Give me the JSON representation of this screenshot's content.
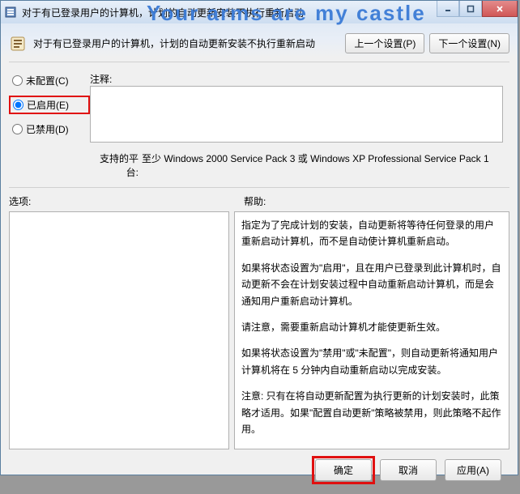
{
  "window": {
    "title": "对于有已登录用户的计算机，计划的自动更新安装不执行重新启动"
  },
  "watermark": "Your arms are my castle",
  "header": {
    "title": "对于有已登录用户的计算机，计划的自动更新安装不执行重新启动",
    "prev": "上一个设置(P)",
    "next": "下一个设置(N)"
  },
  "radios": {
    "not_configured": "未配置(C)",
    "enabled": "已启用(E)",
    "disabled": "已禁用(D)"
  },
  "comment": {
    "label": "注释:",
    "value": ""
  },
  "platform": {
    "label": "支持的平台:",
    "value": "至少 Windows 2000 Service Pack 3 或 Windows XP Professional Service Pack 1"
  },
  "labels": {
    "options": "选项:",
    "help": "帮助:"
  },
  "help_paragraphs": [
    "指定为了完成计划的安装，自动更新将等待任何登录的用户重新启动计算机，而不是自动使计算机重新启动。",
    "如果将状态设置为\"启用\"，且在用户已登录到此计算机时，自动更新不会在计划安装过程中自动重新启动计算机，而是会通知用户重新启动计算机。",
    "请注意，需要重新启动计算机才能使更新生效。",
    "如果将状态设置为\"禁用\"或\"未配置\"，则自动更新将通知用户计算机将在 5 分钟内自动重新启动以完成安装。",
    "注意: 只有在将自动更新配置为执行更新的计划安装时，此策略才适用。如果\"配置自动更新\"策略被禁用，则此策略不起作用。"
  ],
  "footer": {
    "ok": "确定",
    "cancel": "取消",
    "apply": "应用(A)"
  },
  "icons": {
    "app": "⚙",
    "policy": "📋"
  }
}
